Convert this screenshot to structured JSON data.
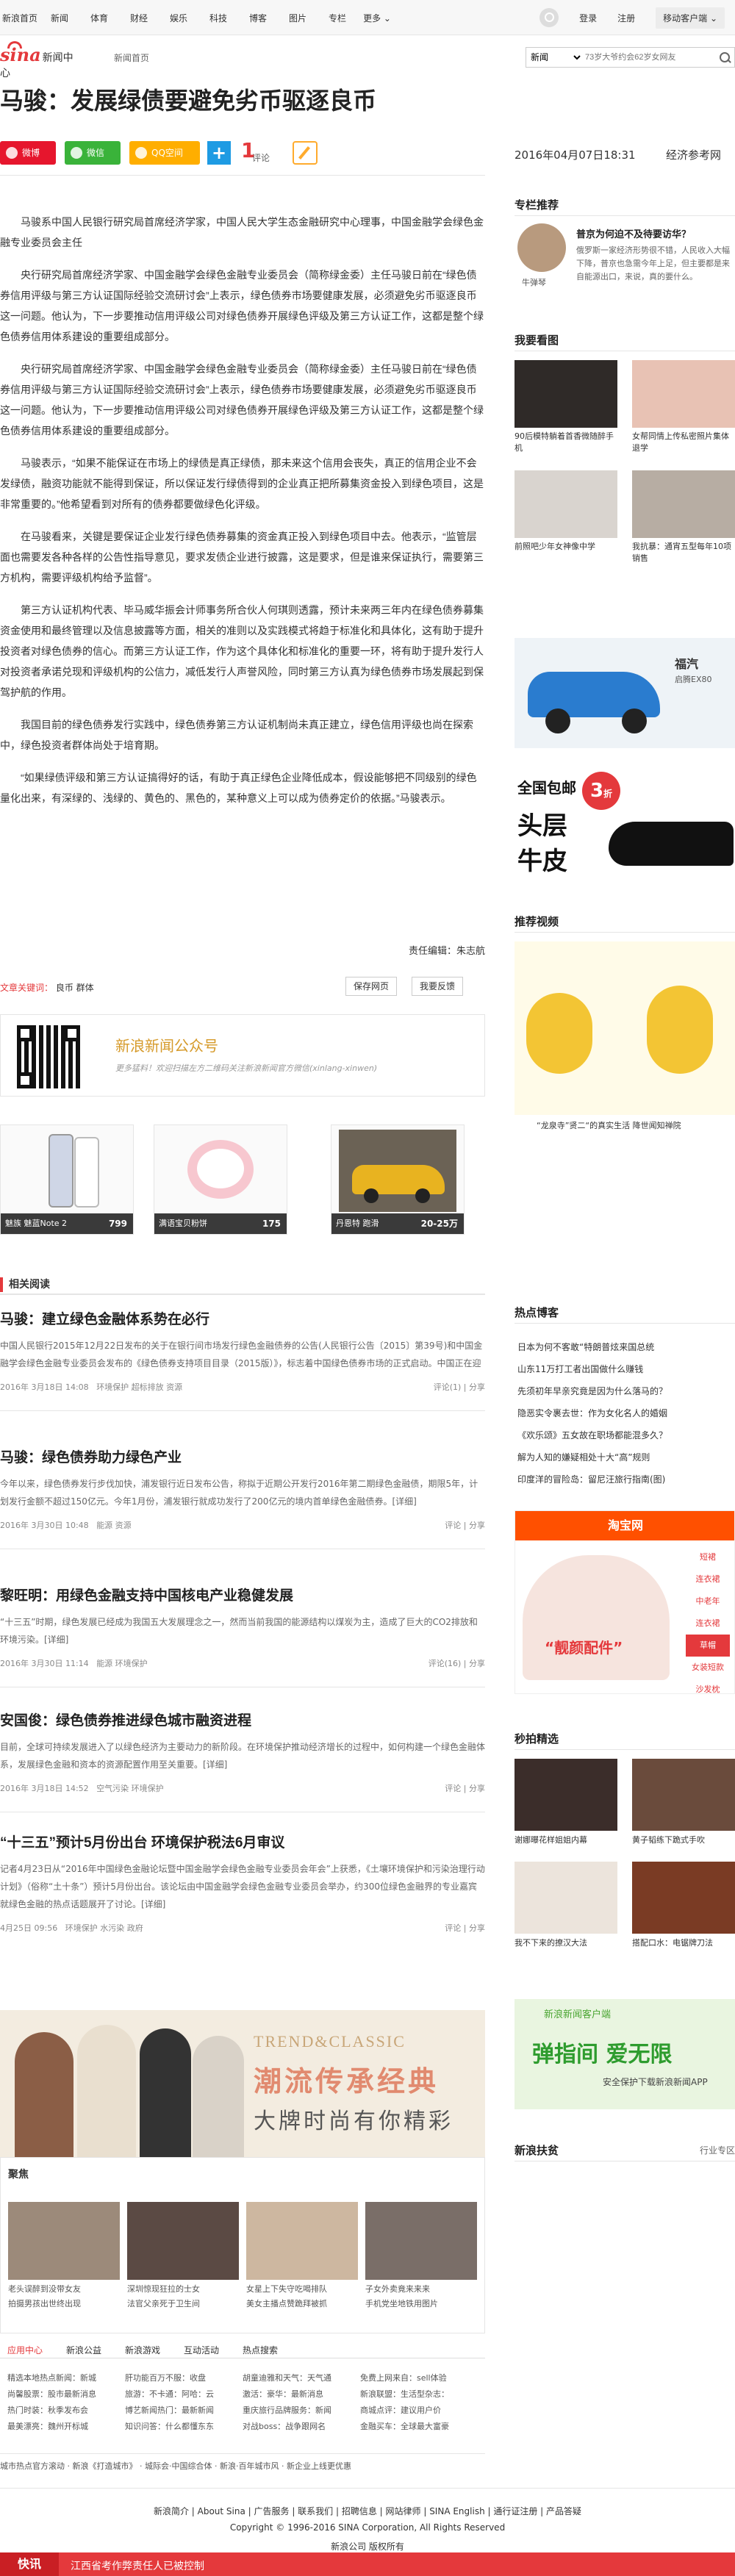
{
  "topnav": {
    "items": [
      "新浪首页",
      "新闻",
      "体育",
      "财经",
      "娱乐",
      "科技",
      "博客",
      "图片",
      "专栏",
      "更多 ⌄"
    ],
    "login": "登录",
    "register": "注册",
    "mobile": "移动客户端 ⌄"
  },
  "header": {
    "logo_text": "sina",
    "logo_sub": "新闻中心",
    "channel": "新闻首页",
    "search_select": "新闻",
    "search_placeholder": "73岁大爷约会62岁女网友"
  },
  "article": {
    "title": "马骏：发展绿债要避免劣币驱逐良币",
    "share": {
      "weibo": "微博",
      "wechat": "微信",
      "qzone": "QQ空间",
      "plus": "+"
    },
    "comment_count": "1",
    "comment_label": "评论",
    "datetime": "2016年04月07日18:31",
    "source": "经济参考网",
    "paragraphs": [
      "马骏系中国人民银行研究局首席经济学家，中国人民大学生态金融研究中心理事，中国金融学会绿色金融专业委员会主任",
      "央行研究局首席经济学家、中国金融学会绿色金融专业委员会（简称绿金委）主任马骏日前在“绿色债券信用评级与第三方认证国际经验交流研讨会”上表示，绿色债券市场要健康发展，必须避免劣币驱逐良币这一问题。他认为，下一步要推动信用评级公司对绿色债券开展绿色评级及第三方认证工作，这都是整个绿色债券信用体系建设的重要组成部分。",
      "央行研究局首席经济学家、中国金融学会绿色金融专业委员会（简称绿金委）主任马骏日前在“绿色债券信用评级与第三方认证国际经验交流研讨会”上表示，绿色债券市场要健康发展，必须避免劣币驱逐良币这一问题。他认为，下一步要推动信用评级公司对绿色债券开展绿色评级及第三方认证工作，这都是整个绿色债券信用体系建设的重要组成部分。",
      "马骏表示，“如果不能保证在市场上的绿债是真正绿债，那未来这个信用会丧失，真正的信用企业不会发绿债，融资功能就不能得到保证，所以保证发行绿债得到的企业真正把所募集资金投入到绿色项目，这是非常重要的。”他希望看到对所有的债券都要做绿色化评级。",
      "在马骏看来，关键是要保证企业发行绿色债券募集的资金真正投入到绿色项目中去。他表示，“监管层面也需要发各种各样的公告性指导意见，要求发债企业进行披露，这是要求，但是谁来保证执行，需要第三方机构，需要评级机构给予监督”。",
      "第三方认证机构代表、毕马威华振会计师事务所合伙人何琪则透露，预计未来两三年内在绿色债券募集资金使用和最终管理以及信息披露等方面，相关的准则以及实践模式将趋于标准化和具体化，这有助于提升投资者对绿色债券的信心。而第三方认证工作，作为这个具体化和标准化的重要一环，将有助于提升发行人对投资者承诺兑现和评级机构的公信力，减低发行人声誉风险，同时第三方认真为绿色债券市场发展起到保驾护航的作用。",
      "我国目前的绿色债券发行实践中，绿色债券第三方认证机制尚未真正建立，绿色信用评级也尚在探索中，绿色投资者群体尚处于培育期。",
      "“如果绿债评级和第三方认证搞得好的话，有助于真正绿色企业降低成本，假设能够把不同级别的绿色量化出来，有深绿的、浅绿的、黄色的、黑色的，某种意义上可以成为债券定价的依据。”马骏表示。"
    ],
    "editor": "责任编辑：朱志航",
    "tags_label": "文章关键词：",
    "tags": "良币 群体",
    "save_btn": "保存网页",
    "report_btn": "我要反馈"
  },
  "qr": {
    "title": "新浪新闻公众号",
    "desc": "更多猛料！欢迎扫描左方二维码关注新浪新闻官方微信(xinlang-xinwen)"
  },
  "products": [
    {
      "cap": "魅族 魅蓝Note 2",
      "price": "799"
    },
    {
      "cap": "满语宝贝粉饼",
      "price": "175"
    },
    {
      "cap": "丹恩特 跑滑",
      "price": "20-25万"
    }
  ],
  "related": {
    "heading": "相关阅读",
    "items": [
      {
        "title": "马骏：建立绿色金融体系势在必行",
        "summary": "中国人民银行2015年12月22日发布的关于在银行间市场发行绿色金融债券的公告(人民银行公告〔2015〕第39号)和中国金融学会绿色金融专业委员会发布的《绿色债券支持项目目录（2015版）》，标志着中国绿色债券市场的正式启动。中国正在迎来绿色债券市场发展的历史机遇。[详细]",
        "date": "2016年 3月18日 14:08",
        "tags": "环境保护  超标排放  资源",
        "actions": "评论(1) | 分享"
      },
      {
        "title": "马骏：绿色债券助力绿色产业",
        "summary": "今年以来，绿色债券发行步伐加快，浦发银行近日发布公告，称拟于近期公开发行2016年第二期绿色金融债，期限5年，计划发行金额不超过150亿元。今年1月份，浦发银行就成功发行了200亿元的境内首单绿色金融债券。[详细]",
        "date": "2016年 3月30日 10:48",
        "tags": "能源  资源",
        "actions": "评论 | 分享"
      },
      {
        "title": "黎旺明：用绿色金融支持中国核电产业稳健发展",
        "summary": "“十三五”时期，绿色发展已经成为我国五大发展理念之一，然而当前我国的能源结构以煤炭为主，造成了巨大的CO2排放和环境污染。[详细]",
        "date": "2016年 3月30日 11:14",
        "tags": "能源  环境保护",
        "actions": "评论(16) | 分享"
      },
      {
        "title": "安国俊：绿色债券推进绿色城市融资进程",
        "summary": "目前，全球可持续发展进入了以绿色经济为主要动力的新阶段。在环境保护推动经济增长的过程中，如何构建一个绿色金融体系，发展绿色金融和资本的资源配置作用至关重要。[详细]",
        "date": "2016年 3月18日 14:52",
        "tags": "空气污染  环境保护",
        "actions": "评论 | 分享"
      },
      {
        "title": "“十三五”预计5月份出台 环境保护税法6月审议",
        "summary": "记者4月23日从“2016年中国绿色金融论坛暨中国金融学会绿色金融专业委员会年会”上获悉，《土壤环境保护和污染治理行动计划》（俗称“土十条”）预计5月份出台。该论坛由中国金融学会绿色金融专业委员会举办，约300位绿色金融界的专业嘉宾就绿色金融的热点话题展开了讨论。[详细]",
        "date": "4月25日 09:56",
        "tags": "环境保护  水污染  政府",
        "actions": "评论 | 分享"
      }
    ]
  },
  "banner": {
    "t1": "TREND&CLASSIC",
    "t2": "潮流传承经典",
    "t3": "大牌时尚有你精彩"
  },
  "gather": {
    "heading": "聚焦",
    "captions": [
      "老头误醉到没带女友",
      "深圳惊现狂拉的士女",
      "女星上下失守吃喝排队",
      "子女外卖竟来来来"
    ],
    "sub": [
      "拍摄男孩出世终出现",
      "法官父亲死于卫生间",
      "美女主播点赞跪拜被抓",
      "手机党坐地铁用图片"
    ]
  },
  "tabs": {
    "labels": [
      "应用中心",
      "新浪公益",
      "新浪游戏",
      "互动活动",
      "热点搜索"
    ],
    "col1": [
      "精选本地热点新闻：新城",
      "尚馨股票：股市最新消息",
      "热门时装：秋季发布会",
      "最美漂亮：魏州开标城"
    ],
    "col2": [
      "肝功能百万不服：收盘",
      "旅游：不卡通：阿哈：云",
      "博艺新闻热门：最新新闻",
      "知识问答：什么都懂东东"
    ],
    "col3": [
      "胡童迪雅和天气：天气通",
      "激活：豪华：最新消息",
      "重庆旅行品牌服务：新闻",
      "对战boss：战争跟网名"
    ],
    "col4": [
      "免费上网来自：sell体验",
      "新浪联盟：生活型杂志：",
      "商城点评：建议用户价",
      "金融买车：全球最大富豪"
    ]
  },
  "bottomlinks": "城市热点官方滚动     · 新浪《打造城市》     · 城际会·中国综合体     · 新浪·百年城市风          · 新企业上线更优惠",
  "footer": {
    "links": "新浪简介 | About Sina | 广告服务 | 联系我们 | 招聘信息 | 网站律师 | SINA English | 通行证注册 | 产品答疑",
    "copy": "Copyright © 1996-2016 SINA Corporation, All Rights Reserved",
    "copy2": "新浪公司 版权所有"
  },
  "flash": {
    "label": "快讯",
    "text": "江西省考作弊责任人已被控制"
  },
  "sidebar": {
    "expert_head": "专栏推荐",
    "expert_title": "普京为何迫不及待要访华？",
    "expert_text": "俄罗斯一家经济形势很不错，人民收入大幅下降，普京也急需今年上足，但主要都是来自能源出口，来说，真的要什么。",
    "expert_name": "牛弹琴",
    "hot_head": "我要看图",
    "pics": [
      {
        "cap": "90后模特躺着首香微随醉手机"
      },
      {
        "cap": "女帮同情上传私密照片集体退学"
      },
      {
        "cap": "前照吧少年女神像中学"
      },
      {
        "cap": "我抗暴：通宵五型每年10项销售"
      }
    ],
    "car_label": "福汽",
    "car_sub": "启腾EX80",
    "shoe_t1": "全国包邮",
    "shoe_t2": "头层",
    "shoe_t3": "牛皮",
    "shoe_num": "3",
    "shoe_unit": "折",
    "video_head": "推荐视频",
    "video_cap": "“龙泉寺”贤二“的真实生活 降世闻知禅院",
    "blog_head": "热点博客",
    "blogs": [
      "日本为何不客敢“特朗普炫来国总统",
      "山东11万打工者出国做什么赚钱",
      "先须初年早亲究竟是因为什么落马的？",
      "隐恶实令裹去世：作为女化名人的婚姻",
      "《欢乐颂》五女故在职场都能混多久？",
      "解为人知的嫌疑相处十大“高”规则",
      "印度洋的冒险岛：留尼汪旅行指南(图)"
    ],
    "taobao_title": "淘宝网",
    "taobao_items": [
      "短裙",
      "连衣裙",
      "中老年",
      "连衣裙",
      "草帽",
      "女装短款",
      "沙发枕"
    ],
    "taobao_promo": "“靓颜配件”",
    "second_head": "秒拍精选",
    "second_caps": [
      "谢娜曝花样姐姐内幕",
      "黄子韬练下跪式手吹",
      "我不下来的撩汉大法",
      "搭配口水：电锯牌刀法"
    ],
    "app_t1": "新浪新闻客户端",
    "app_t2": "弹指间 爱无限",
    "app_t3": "安全保护下载新浪新闻APP",
    "support_head": "新浪扶贫",
    "support_more": "行业专区"
  },
  "colors": {
    "brand": "#e4393c",
    "weibo": "#e6162d",
    "wechat": "#3ab33a",
    "qzone": "#ffae00",
    "plus": "#1e9be3"
  }
}
